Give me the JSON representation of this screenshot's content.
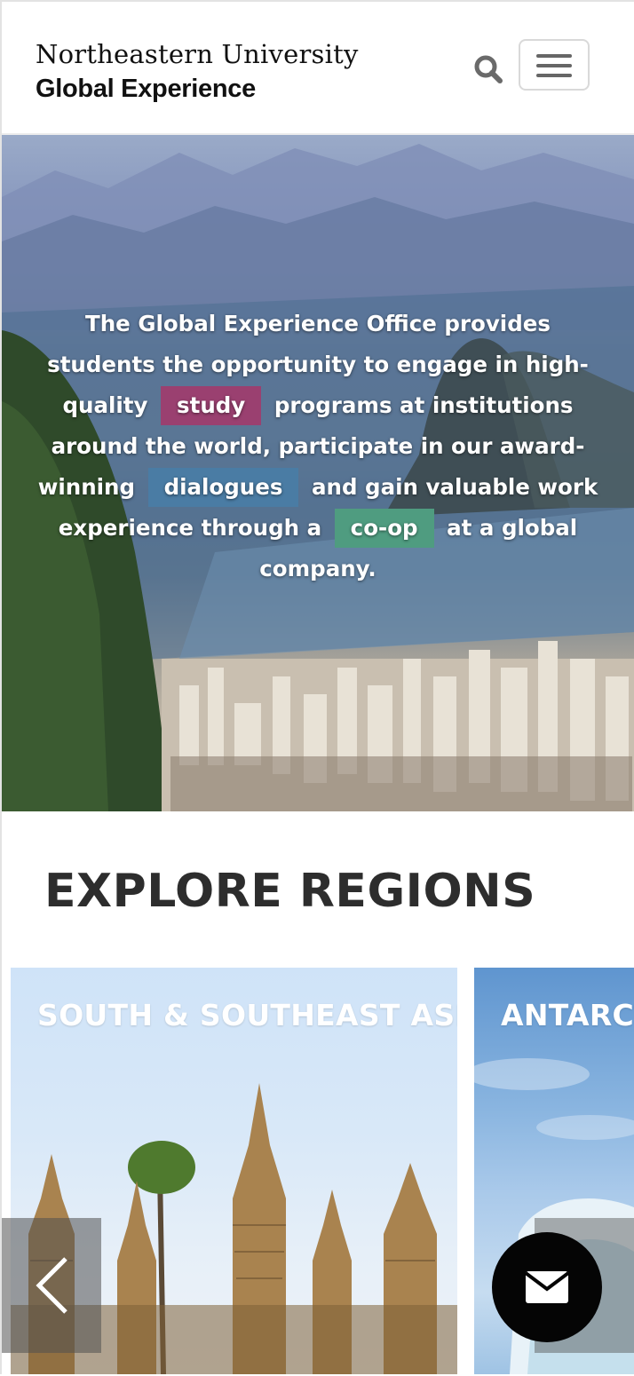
{
  "header": {
    "logo_line1": "Northeastern University",
    "logo_line2": "Global Experience",
    "search_icon": "search-icon",
    "menu_icon": "hamburger-menu-icon"
  },
  "hero": {
    "text_before_study": "The Global Experience Office provides students the opportunity to engage in high-quality",
    "study_label": "study",
    "text_before_dialogues": "programs at institutions around the world, participate in our award-winning",
    "dialogues_label": "dialogues",
    "text_before_coop": "and gain valuable work experience through a",
    "coop_label": "co-op",
    "text_end": "at a global company.",
    "colors": {
      "study": "#9a4070",
      "dialogues": "#4a7ca4",
      "coop": "#4f9c80"
    }
  },
  "explore": {
    "title": "EXPLORE REGIONS",
    "regions": [
      {
        "label": "SOUTH & SOUTHEAST ASIA"
      },
      {
        "label": "ANTARCTICA"
      }
    ],
    "prev_icon": "chevron-left-icon",
    "next_icon": "chevron-right-icon"
  },
  "contact": {
    "icon": "mail-icon"
  }
}
